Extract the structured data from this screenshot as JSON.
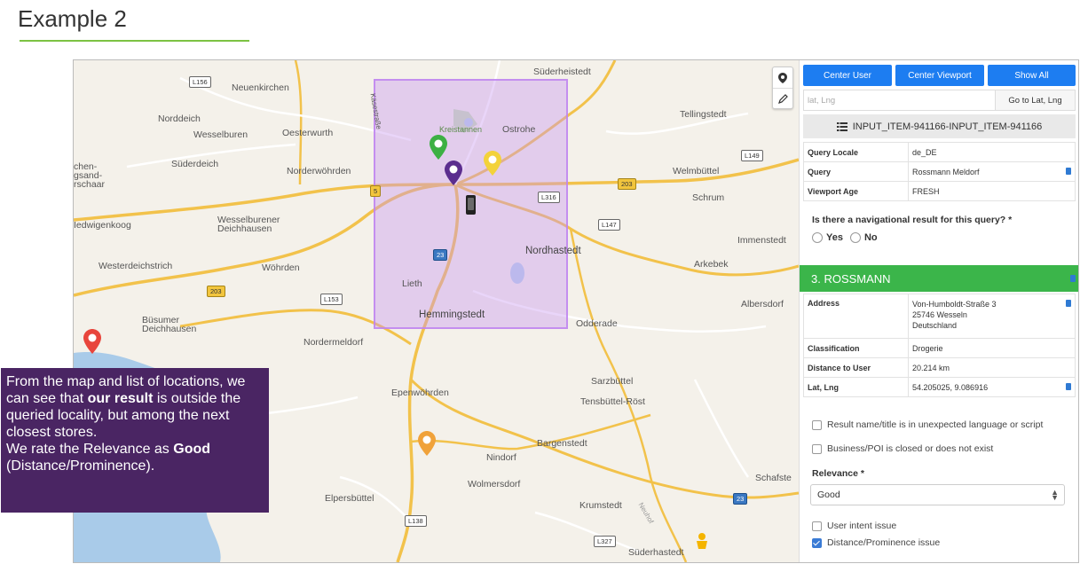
{
  "slide": {
    "title": "Example 2",
    "accent_color": "#7cc243"
  },
  "map": {
    "places": [
      {
        "name": "Süderheistedt"
      },
      {
        "name": "Neuenkirchen"
      },
      {
        "name": "Norddeich"
      },
      {
        "name": "Wesselburen"
      },
      {
        "name": "Oesterwurth"
      },
      {
        "name": "Tellingstedt"
      },
      {
        "name": "Kreistannen"
      },
      {
        "name": "Ostrohe"
      },
      {
        "name": "Süderdeich"
      },
      {
        "name": "Norderwöhrden"
      },
      {
        "name": "Welmbüttel"
      },
      {
        "name": "Schrum"
      },
      {
        "name": "chen-"
      },
      {
        "name": "gsand-"
      },
      {
        "name": "rschaar"
      },
      {
        "name": "Wesselburener"
      },
      {
        "name": "Deichhausen"
      },
      {
        "name": "Iedwigenkoog"
      },
      {
        "name": "Immenstedt"
      },
      {
        "name": "Nordhastedt"
      },
      {
        "name": "Westerdeichstrich"
      },
      {
        "name": "Wöhrden"
      },
      {
        "name": "Arkebek"
      },
      {
        "name": "Lieth"
      },
      {
        "name": "Hemmingstedt"
      },
      {
        "name": "Albersdorf"
      },
      {
        "name": "Büsumer"
      },
      {
        "name": "Deichhausen"
      },
      {
        "name": "Odderade"
      },
      {
        "name": "Nordermeldorf"
      },
      {
        "name": "Sarzbüttel"
      },
      {
        "name": "Epenwöhrden"
      },
      {
        "name": "Tensbüttel-Röst"
      },
      {
        "name": "Bargenstedt"
      },
      {
        "name": "Nindorf"
      },
      {
        "name": "Wolmersdorf"
      },
      {
        "name": "Schafste"
      },
      {
        "name": "Elpersbüttel"
      },
      {
        "name": "Krumstedt"
      },
      {
        "name": "Süderhastedt"
      },
      {
        "name": "Käsestraße"
      },
      {
        "name": "Neuhof"
      }
    ],
    "road_shields": [
      "L156",
      "L149",
      "203",
      "5",
      "L316",
      "L147",
      "23",
      "203",
      "L153",
      "L138",
      "L327",
      "23"
    ],
    "pins": [
      {
        "color": "#3cb043",
        "label": "green-pin"
      },
      {
        "color": "#5b2d8e",
        "label": "purple-pin"
      },
      {
        "color": "#f3d23b",
        "label": "yellow-pin"
      },
      {
        "color": "#e8453c",
        "label": "red-pin"
      },
      {
        "color": "#f0a23a",
        "label": "orange-pin"
      }
    ],
    "tools": [
      "location-pin-icon",
      "pencil-icon"
    ],
    "viewport_color": "#c89af0"
  },
  "callout": {
    "line1": "From the map and list of locations, we can see that ",
    "bold1": "our result",
    "line2": " is outside the queried locality, but among the next closest stores.",
    "line3": "We rate the Relevance as ",
    "bold2": "Good",
    "line4": " (Distance/Prominence).",
    "bg_color": "#4a2563"
  },
  "panel": {
    "buttons": {
      "center_user": "Center User",
      "center_viewport": "Center Viewport",
      "show_all": "Show All"
    },
    "latlng_placeholder": "lat, Lng",
    "goto_label": "Go to Lat, Lng",
    "item_id": "INPUT_ITEM-941166-INPUT_ITEM-941166",
    "query_rows": [
      {
        "key": "Query Locale",
        "value": "de_DE"
      },
      {
        "key": "Query",
        "value": "Rossmann Meldorf"
      },
      {
        "key": "Viewport Age",
        "value": "FRESH"
      }
    ],
    "question": "Is there a navigational result for this query? *",
    "yes_label": "Yes",
    "no_label": "No",
    "result_title": "3. ROSSMANN",
    "result_header_color": "#3bb54a",
    "address_label": "Address",
    "address_lines": [
      "Von-Humboldt-Straße 3",
      "25746 Wesseln",
      "Deutschland"
    ],
    "detail_rows": [
      {
        "key": "Classification",
        "value": "Drogerie"
      },
      {
        "key": "Distance to User",
        "value": "20.214 km"
      },
      {
        "key": "Lat, Lng",
        "value": "54.205025, 9.086916"
      }
    ],
    "checks_top": [
      {
        "label": "Result name/title is in unexpected language or script",
        "checked": false
      },
      {
        "label": "Business/POI is closed or does not exist",
        "checked": false
      }
    ],
    "relevance_label": "Relevance *",
    "relevance_value": "Good",
    "checks_bottom": [
      {
        "label": "User intent issue",
        "checked": false
      },
      {
        "label": "Distance/Prominence issue",
        "checked": true
      }
    ]
  }
}
